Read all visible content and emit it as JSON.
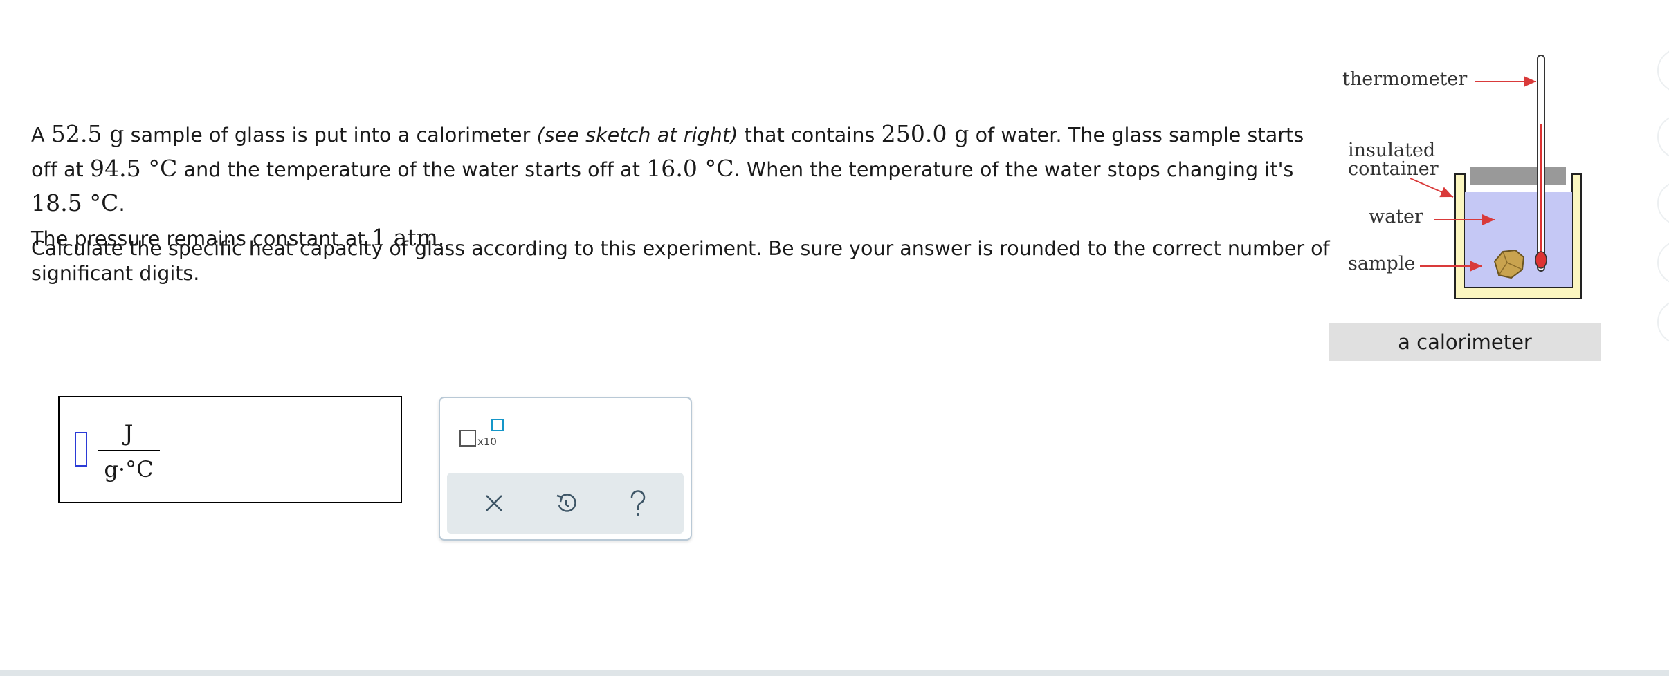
{
  "problem": {
    "t1": "A ",
    "mass_glass": "52.5",
    "unit_g1": " g",
    "t2": " sample of glass is put into a calorimeter ",
    "sketch_note": "(see sketch at right)",
    "t3": " that contains ",
    "mass_water": "250.0",
    "unit_g2": " g",
    "t4": " of water. The glass sample starts off at ",
    "temp_glass": "94.5",
    "unit_c1": " °C",
    "t5": " and the temperature of the water starts off at ",
    "temp_water": "16.0",
    "unit_c2": " °C",
    "t6": ". When the temperature of the water stops changing it's ",
    "temp_final": "18.5",
    "unit_c3": " °C",
    "t7": ".",
    "t8": "The pressure remains constant at ",
    "pressure": "1",
    "unit_atm": " atm",
    "t9": ".",
    "question": "Calculate the specific heat capacity of glass according to this experiment. Be sure your answer is rounded to the correct number of significant digits."
  },
  "figure": {
    "labels": {
      "thermometer": "thermometer",
      "insulated_line1": "insulated",
      "insulated_line2": "container",
      "water": "water",
      "sample": "sample"
    },
    "caption": "a calorimeter",
    "colors": {
      "water": "#c5c8f5",
      "container": "#fbf6c0",
      "lid": "#999999",
      "arrow": "#d93a3a",
      "mercury": "#d33"
    }
  },
  "answer": {
    "value": "",
    "unit_numerator": "J",
    "unit_denominator": "g·°C"
  },
  "toolbar": {
    "sci_notation_label": "x10",
    "icons": [
      "scientific-notation-icon",
      "clear-x-icon",
      "undo-icon",
      "help-question-icon"
    ],
    "accent": "#1596c8"
  }
}
